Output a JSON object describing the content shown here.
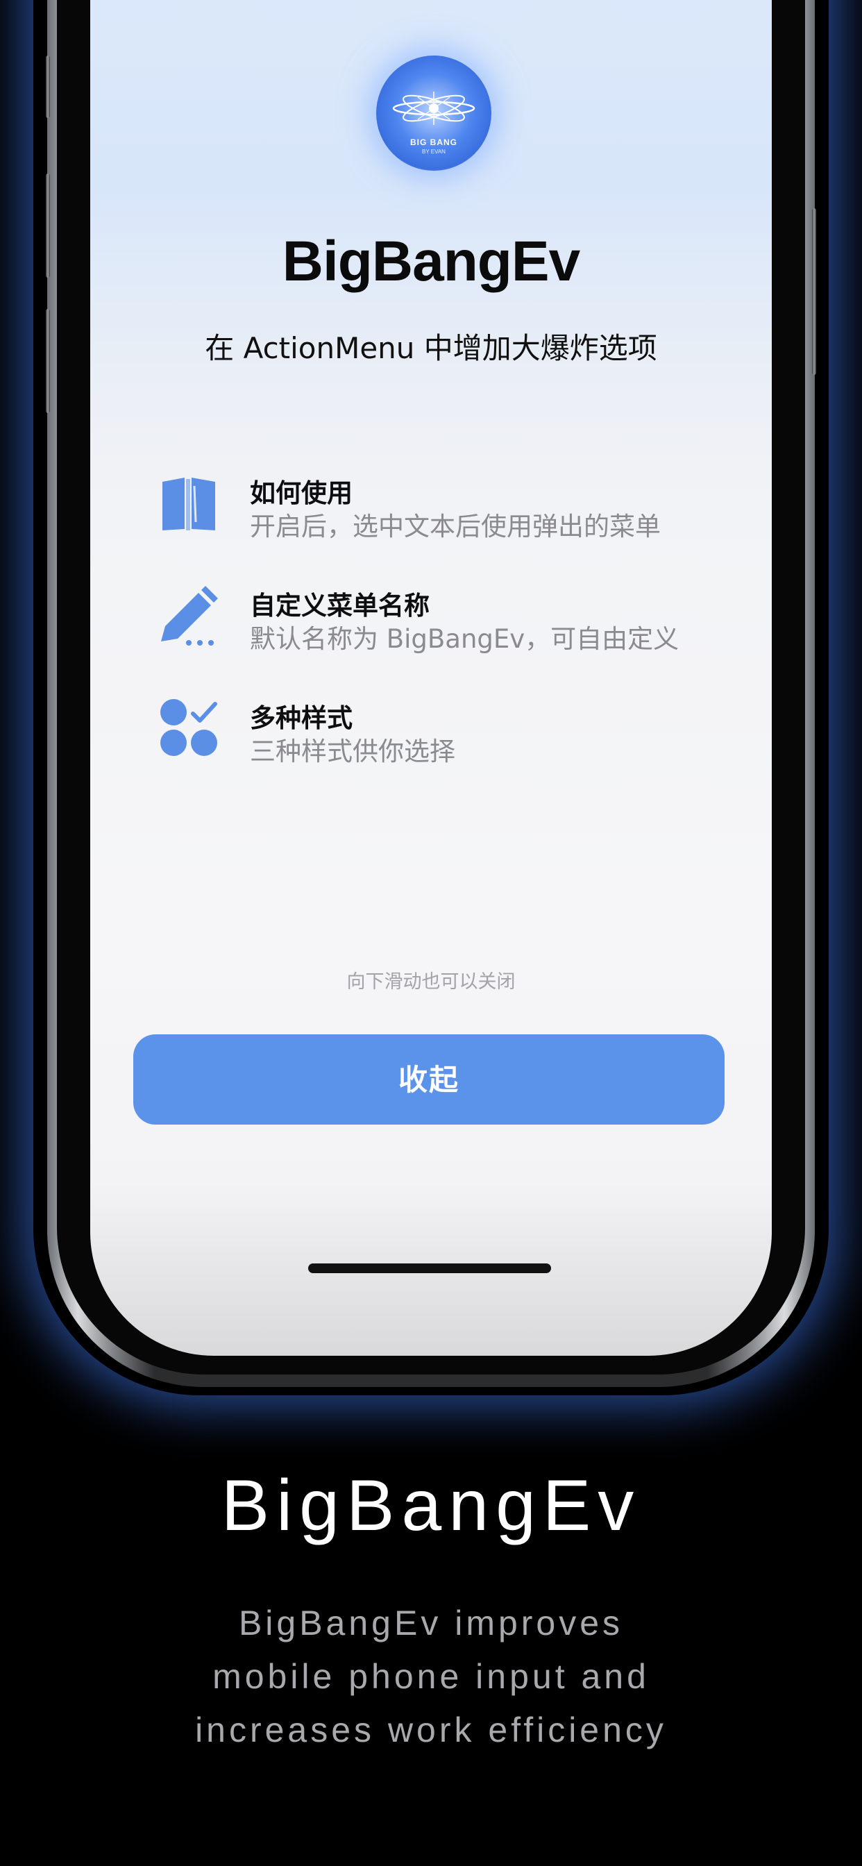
{
  "app": {
    "icon_caption": "BIG BANG",
    "icon_subcaption": "BY EVAN",
    "title": "BigBangEv",
    "subtitle": "在 ActionMenu 中增加大爆炸选项"
  },
  "features": [
    {
      "icon": "book-icon",
      "title": "如何使用",
      "description": "开启后，选中文本后使用弹出的菜单"
    },
    {
      "icon": "pencil-icon",
      "title": "自定义菜单名称",
      "description": "默认名称为 BigBangEv，可自由定义"
    },
    {
      "icon": "styles-check-icon",
      "title": "多种样式",
      "description": "三种样式供你选择"
    }
  ],
  "swipe_hint": "向下滑动也可以关闭",
  "collapse_button_label": "收起",
  "promo": {
    "title": "BigBangEv",
    "description_lines": [
      "BigBangEv improves",
      "mobile phone input and",
      "increases work efficiency"
    ]
  },
  "colors": {
    "accent": "#5b92ea",
    "icon_blue": "#5b8fe6",
    "background": "#000000",
    "glow": "#4682ff"
  }
}
